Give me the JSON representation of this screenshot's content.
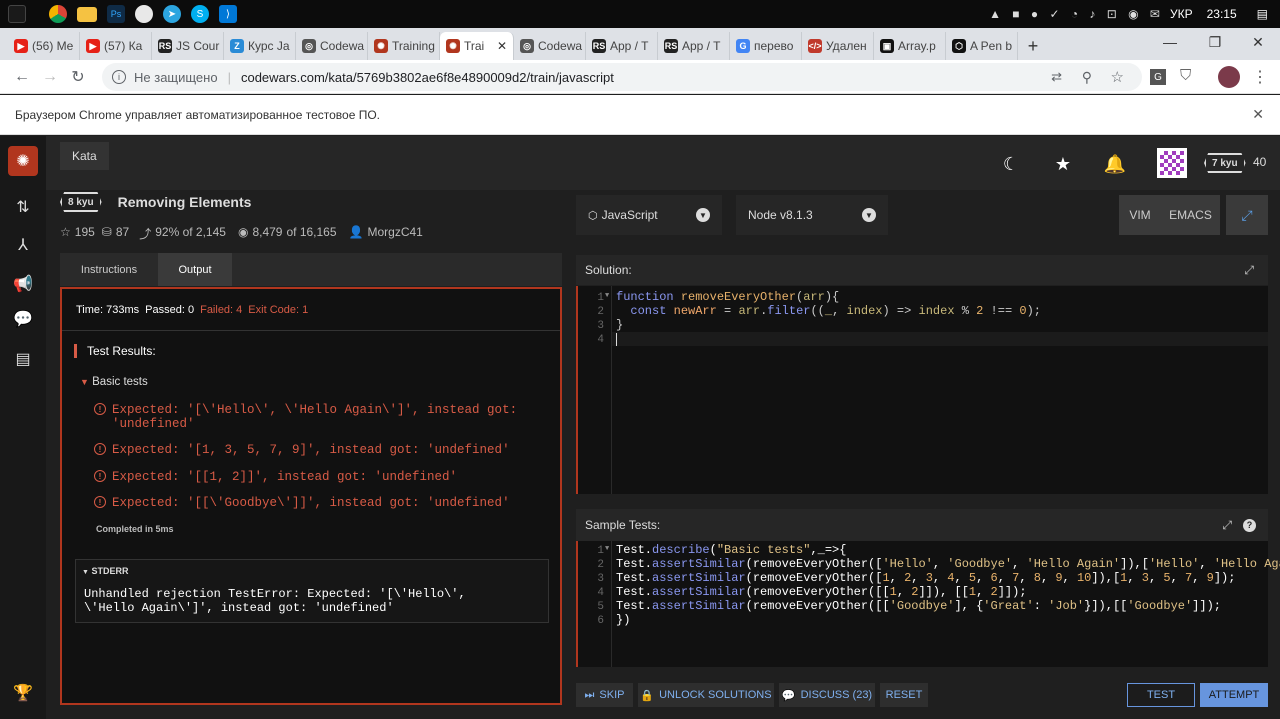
{
  "taskbar": {
    "language": "УКР",
    "time": "23:15"
  },
  "browser": {
    "tabs": [
      {
        "label": "(56) Me",
        "icon": "youtube-icon",
        "color": "#e62117"
      },
      {
        "label": "(57) Ка",
        "icon": "youtube-icon",
        "color": "#e62117"
      },
      {
        "label": "JS Cour",
        "icon": "rs-icon",
        "color": "#222222"
      },
      {
        "label": "Курс Ja",
        "icon": "z-icon",
        "color": "#2a8bd6"
      },
      {
        "label": "Codewa",
        "icon": "globe-icon",
        "color": "#555555"
      },
      {
        "label": "Training",
        "icon": "codewars-icon",
        "color": "#b1361e"
      },
      {
        "label": "Trai",
        "icon": "codewars-icon",
        "color": "#b1361e"
      },
      {
        "label": "Codewa",
        "icon": "globe-icon",
        "color": "#555555"
      },
      {
        "label": "App / T",
        "icon": "rs-icon",
        "color": "#222222"
      },
      {
        "label": "App / T",
        "icon": "rs-icon",
        "color": "#222222"
      },
      {
        "label": "перево",
        "icon": "google-icon",
        "color": "#4285f4"
      },
      {
        "label": "Удален",
        "icon": "code-icon",
        "color": "#c0392b"
      },
      {
        "label": "Array.p",
        "icon": "mdn-icon",
        "color": "#111111"
      },
      {
        "label": "A Pen b",
        "icon": "codepen-icon",
        "color": "#111111"
      }
    ],
    "active_tab_index": 6,
    "security_label": "Не защищено",
    "url": "codewars.com/kata/5769b3802ae6f8e4890009d2/train/javascript",
    "infobar_text": "Браузером Chrome управляет автоматизированное тестовое ПО."
  },
  "header": {
    "kata_label": "Kata",
    "rank_badge": "7 kyu",
    "honor": "40"
  },
  "kata": {
    "kyu": "8 kyu",
    "title": "Removing Elements",
    "stars": "195",
    "collections": "87",
    "satisfaction": "92% of 2,145",
    "completed": "8,479",
    "attempts": "of 16,165",
    "author": "MorgzC41"
  },
  "left_tabs": {
    "instructions": "Instructions",
    "output": "Output"
  },
  "output": {
    "time": "Time: 733ms",
    "passed": "Passed: 0",
    "failed": "Failed: 4",
    "exit_code": "Exit Code: 1",
    "test_results_label": "Test Results:",
    "group_label": "Basic tests",
    "errors": [
      "Expected: '[\\'Hello\\', \\'Hello Again\\']', instead got:",
      "'undefined'",
      "Expected: '[1, 3, 5, 7, 9]', instead got: 'undefined'",
      "Expected: '[[1, 2]]', instead got: 'undefined'",
      "Expected: '[[\\'Goodbye\\']]', instead got: 'undefined'"
    ],
    "completed_in": "Completed in 5ms",
    "stderr_label": "STDERR",
    "stderr_lines": [
      "Unhandled rejection TestError: Expected: '[\\'Hello\\',",
      "\\'Hello Again\\']', instead got: 'undefined'"
    ]
  },
  "editor": {
    "language": "JavaScript",
    "node_version": "Node v8.1.3",
    "vim_label": "VIM",
    "emacs_label": "EMACS",
    "solution_label": "Solution:",
    "sample_tests_label": "Sample Tests:"
  },
  "solution_lines": [
    "1",
    "2",
    "3",
    "4"
  ],
  "test_lines": [
    "1",
    "2",
    "3",
    "4",
    "5",
    "6"
  ],
  "bottom_bar": {
    "skip": "SKIP",
    "unlock": "UNLOCK SOLUTIONS",
    "discuss": "DISCUSS (23)",
    "reset": "RESET",
    "test": "TEST",
    "attempt": "ATTEMPT"
  },
  "colors": {
    "accent_red": "#b1361e",
    "error_red": "#d85b46",
    "blue": "#6795de"
  }
}
